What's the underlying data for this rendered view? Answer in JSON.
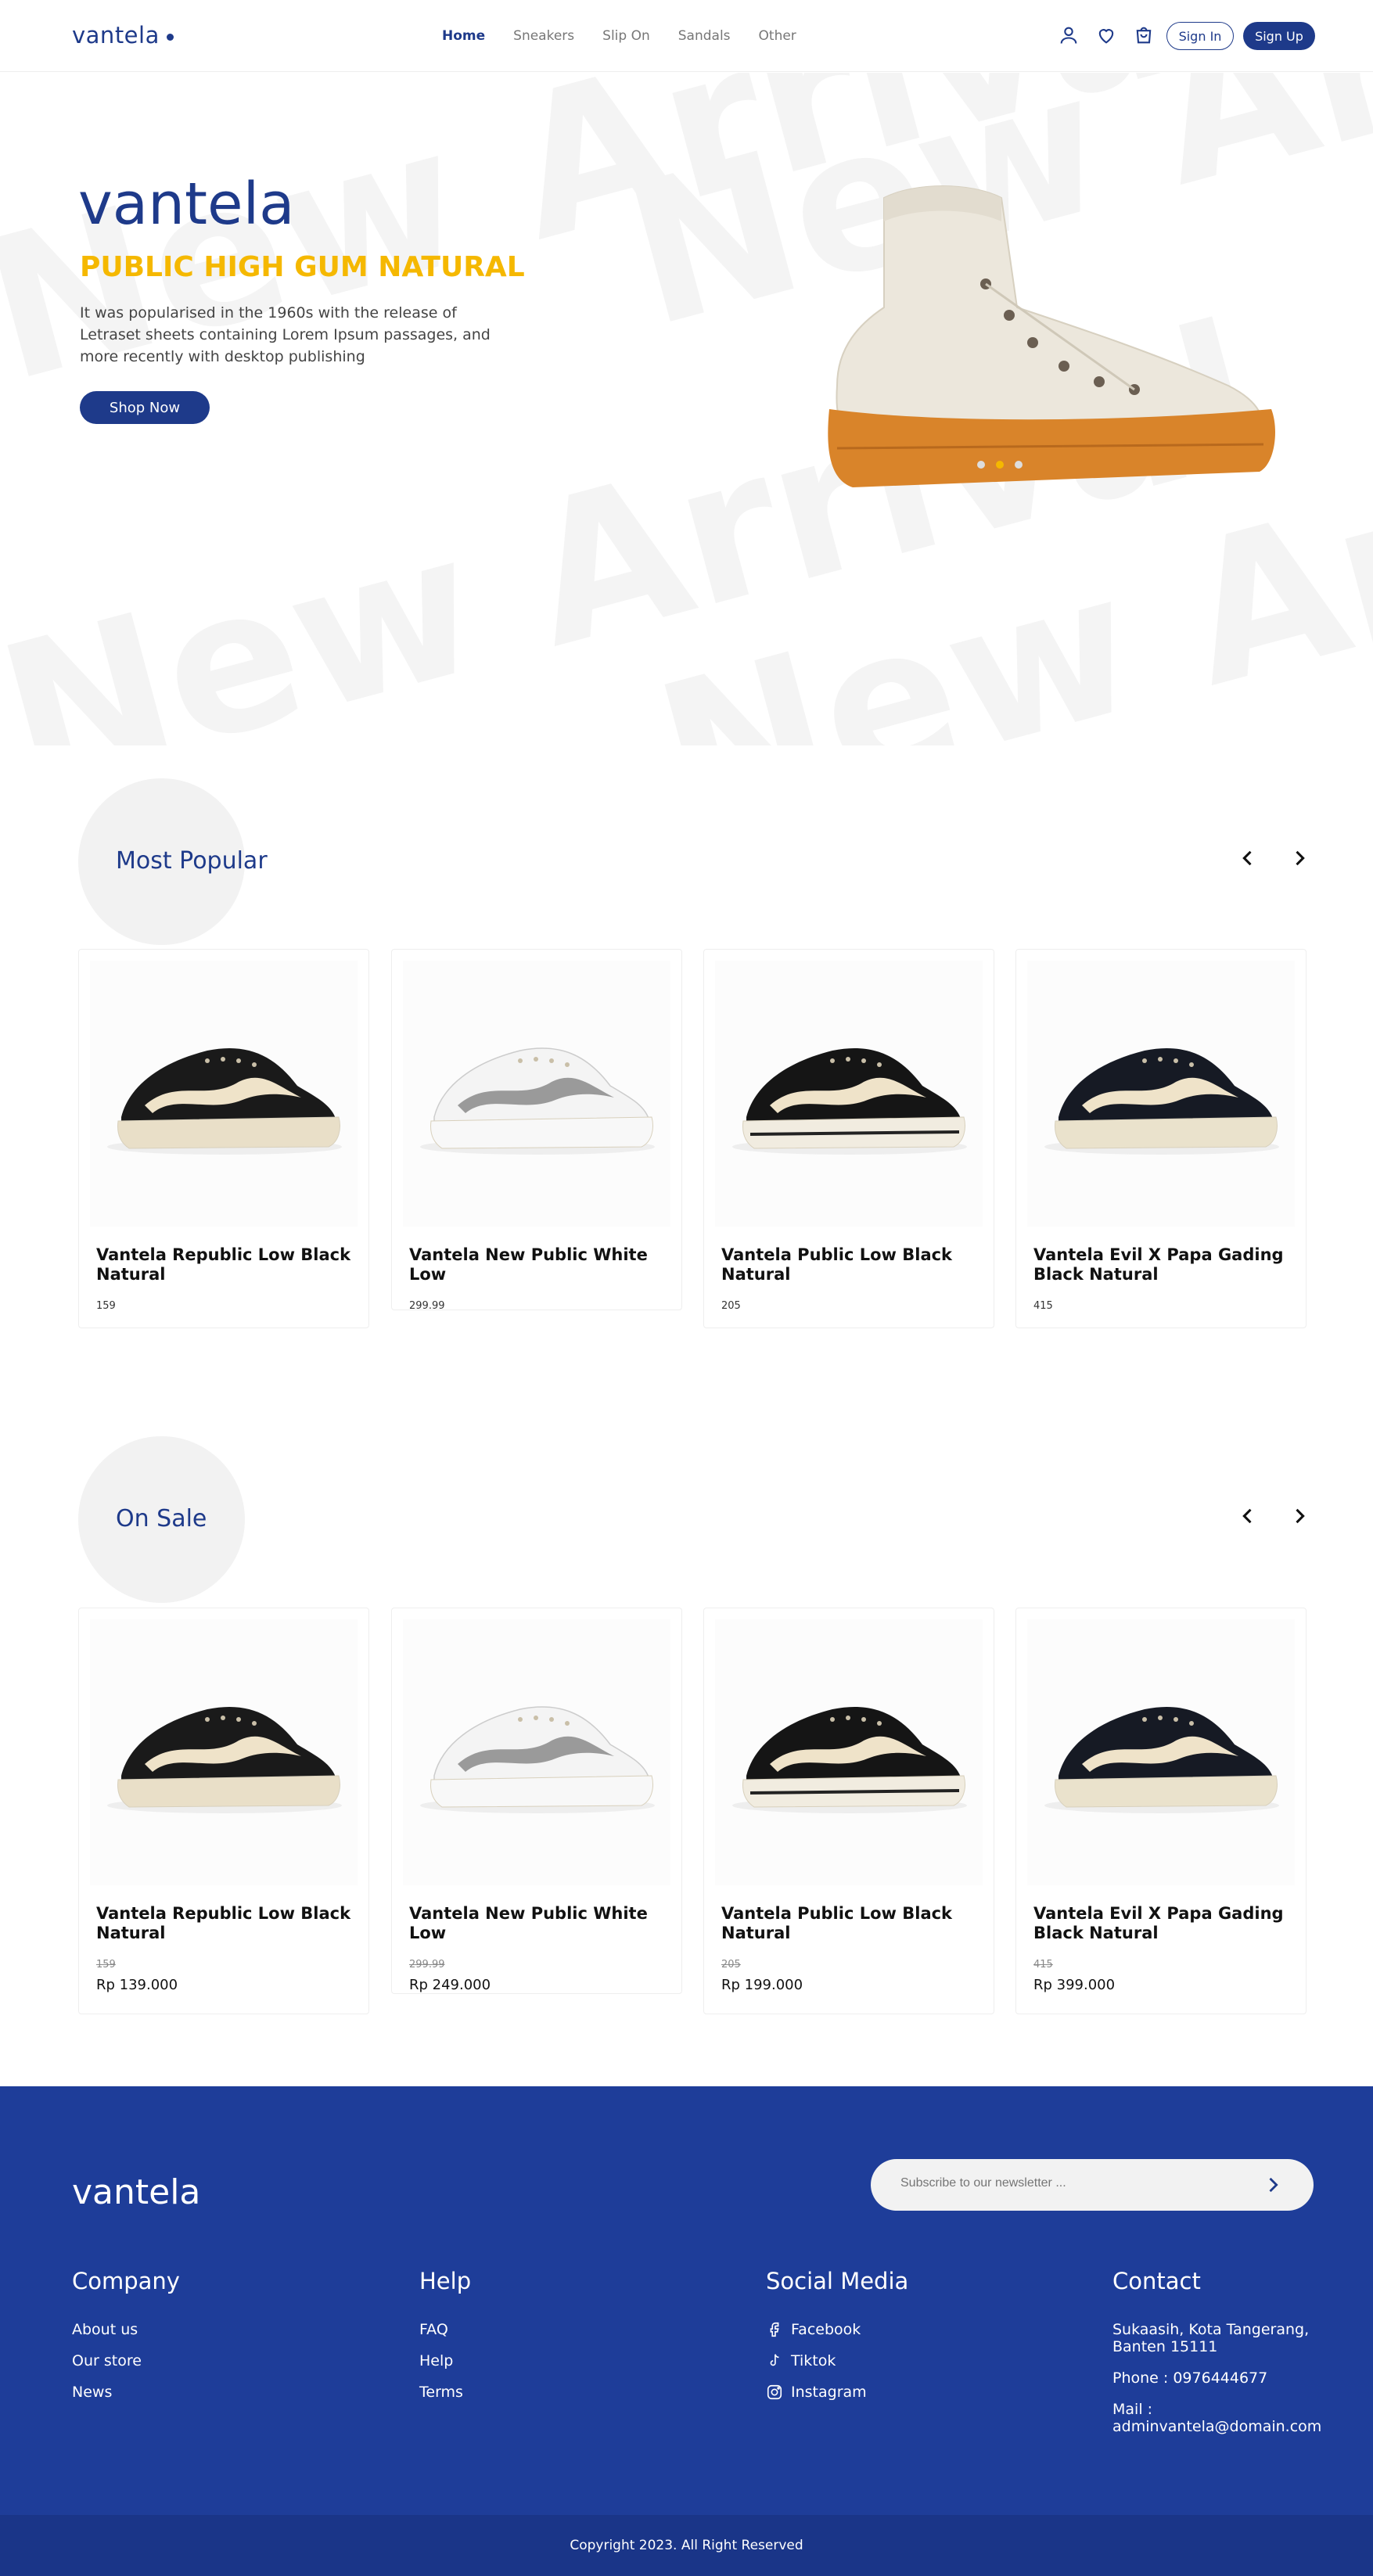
{
  "header": {
    "logo": "vantela",
    "nav": [
      "Home",
      "Sneakers",
      "Slip On",
      "Sandals",
      "Other"
    ],
    "sign_in": "Sign In",
    "sign_up": "Sign Up",
    "icons": [
      "user-icon",
      "heart-icon",
      "cart-icon"
    ]
  },
  "hero": {
    "brand": "vantela",
    "title": "PUBLIC HIGH GUM NATURAL",
    "description": "It was popularised in the 1960s with the release of Letraset sheets containing Lorem Ipsum passages, and more recently with desktop publishing",
    "button": "Shop Now",
    "watermark": "New Arrival",
    "slide_count": 3,
    "active_slide": 2
  },
  "popular": {
    "title": "Most Popular",
    "products": [
      {
        "name": "Vantela Republic Low Black Natural",
        "price": "159"
      },
      {
        "name": "Vantela New Public White Low",
        "price": "299.99"
      },
      {
        "name": "Vantela Public Low Black Natural",
        "price": "205"
      },
      {
        "name": "Vantela Evil X Papa Gading Black Natural",
        "price": "415"
      }
    ]
  },
  "sale": {
    "title": "On Sale",
    "products": [
      {
        "name": "Vantela Republic Low Black Natural",
        "old_price": "159",
        "price": "Rp 139.000"
      },
      {
        "name": "Vantela New Public White Low",
        "old_price": "299.99",
        "price": "Rp 249.000"
      },
      {
        "name": "Vantela Public Low Black Natural",
        "old_price": "205",
        "price": "Rp 199.000"
      },
      {
        "name": "Vantela Evil X Papa Gading Black Natural",
        "old_price": "415",
        "price": "Rp 399.000"
      }
    ]
  },
  "footer": {
    "logo": "vantela",
    "newsletter_placeholder": "Subscribe to our newsletter ...",
    "company": {
      "title": "Company",
      "links": [
        "About us",
        "Our store",
        "News"
      ]
    },
    "help": {
      "title": "Help",
      "links": [
        "FAQ",
        "Help",
        "Terms"
      ]
    },
    "social": {
      "title": "Social Media",
      "links": [
        "Facebook",
        "Tiktok",
        "Instagram"
      ]
    },
    "contact": {
      "title": "Contact",
      "address": "Sukaasih, Kota Tangerang, Banten 15111",
      "phone": "Phone : 0976444677",
      "mail": "Mail : adminvantela@domain.com"
    },
    "copyright": "Copyright 2023. All Right Reserved"
  },
  "colors": {
    "brand": "#1e3a8a",
    "accent": "#f5b800",
    "footer": "#1e3d99"
  }
}
